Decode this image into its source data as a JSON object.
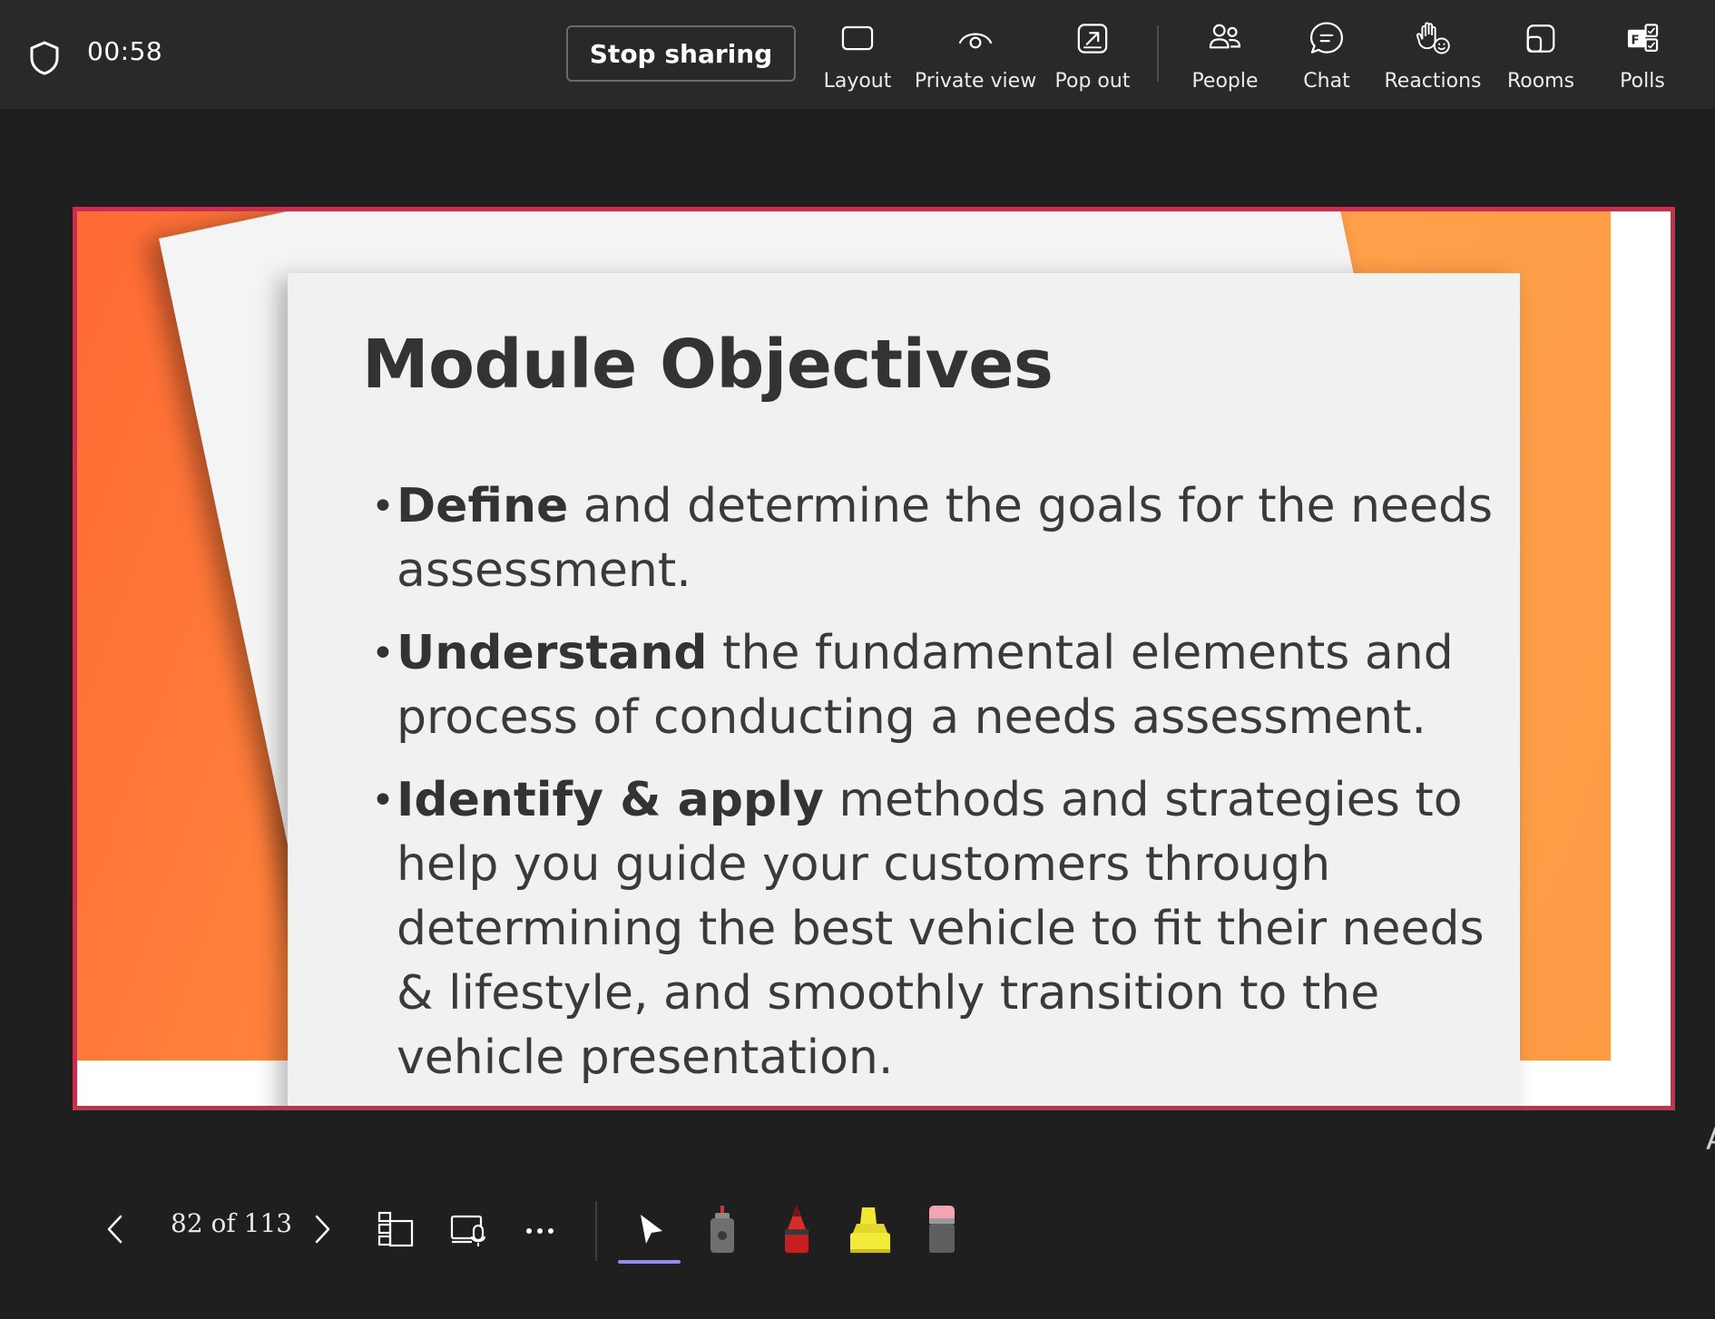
{
  "topbar": {
    "timer": "00:58",
    "stop_sharing": "Stop sharing",
    "items": [
      {
        "label": "Layout",
        "icon": "layout-icon"
      },
      {
        "label": "Private view",
        "icon": "eye-icon"
      },
      {
        "label": "Pop out",
        "icon": "pop-out-icon"
      },
      {
        "label": "People",
        "icon": "people-icon"
      },
      {
        "label": "Chat",
        "icon": "chat-icon"
      },
      {
        "label": "Reactions",
        "icon": "reactions-icon"
      },
      {
        "label": "Rooms",
        "icon": "rooms-icon"
      },
      {
        "label": "Polls",
        "icon": "polls-icon"
      }
    ]
  },
  "slide": {
    "title": "Module Objectives",
    "bullets": [
      {
        "bold": "Define",
        "text": " and determine the goals for the needs assessment."
      },
      {
        "bold": "Understand",
        "text": " the fundamental elements and process of conducting a needs assessment."
      },
      {
        "bold": "Identify & apply",
        "text": " methods and strategies to help you guide your customers through determining the best vehicle to fit their needs & lifestyle, and smoothly transition to the vehicle presentation."
      }
    ]
  },
  "bottombar": {
    "page_counter": "82 of 113",
    "tools": [
      "pointer-icon",
      "laser-pointer-icon",
      "red-pen-icon",
      "highlighter-icon",
      "eraser-icon"
    ],
    "active_tool": "pointer-icon"
  },
  "colors": {
    "frame_border": "#c4314b",
    "slide_orange": "#ff8a3e",
    "active_underline": "#8f8ef0"
  },
  "edge_glyph": "A"
}
